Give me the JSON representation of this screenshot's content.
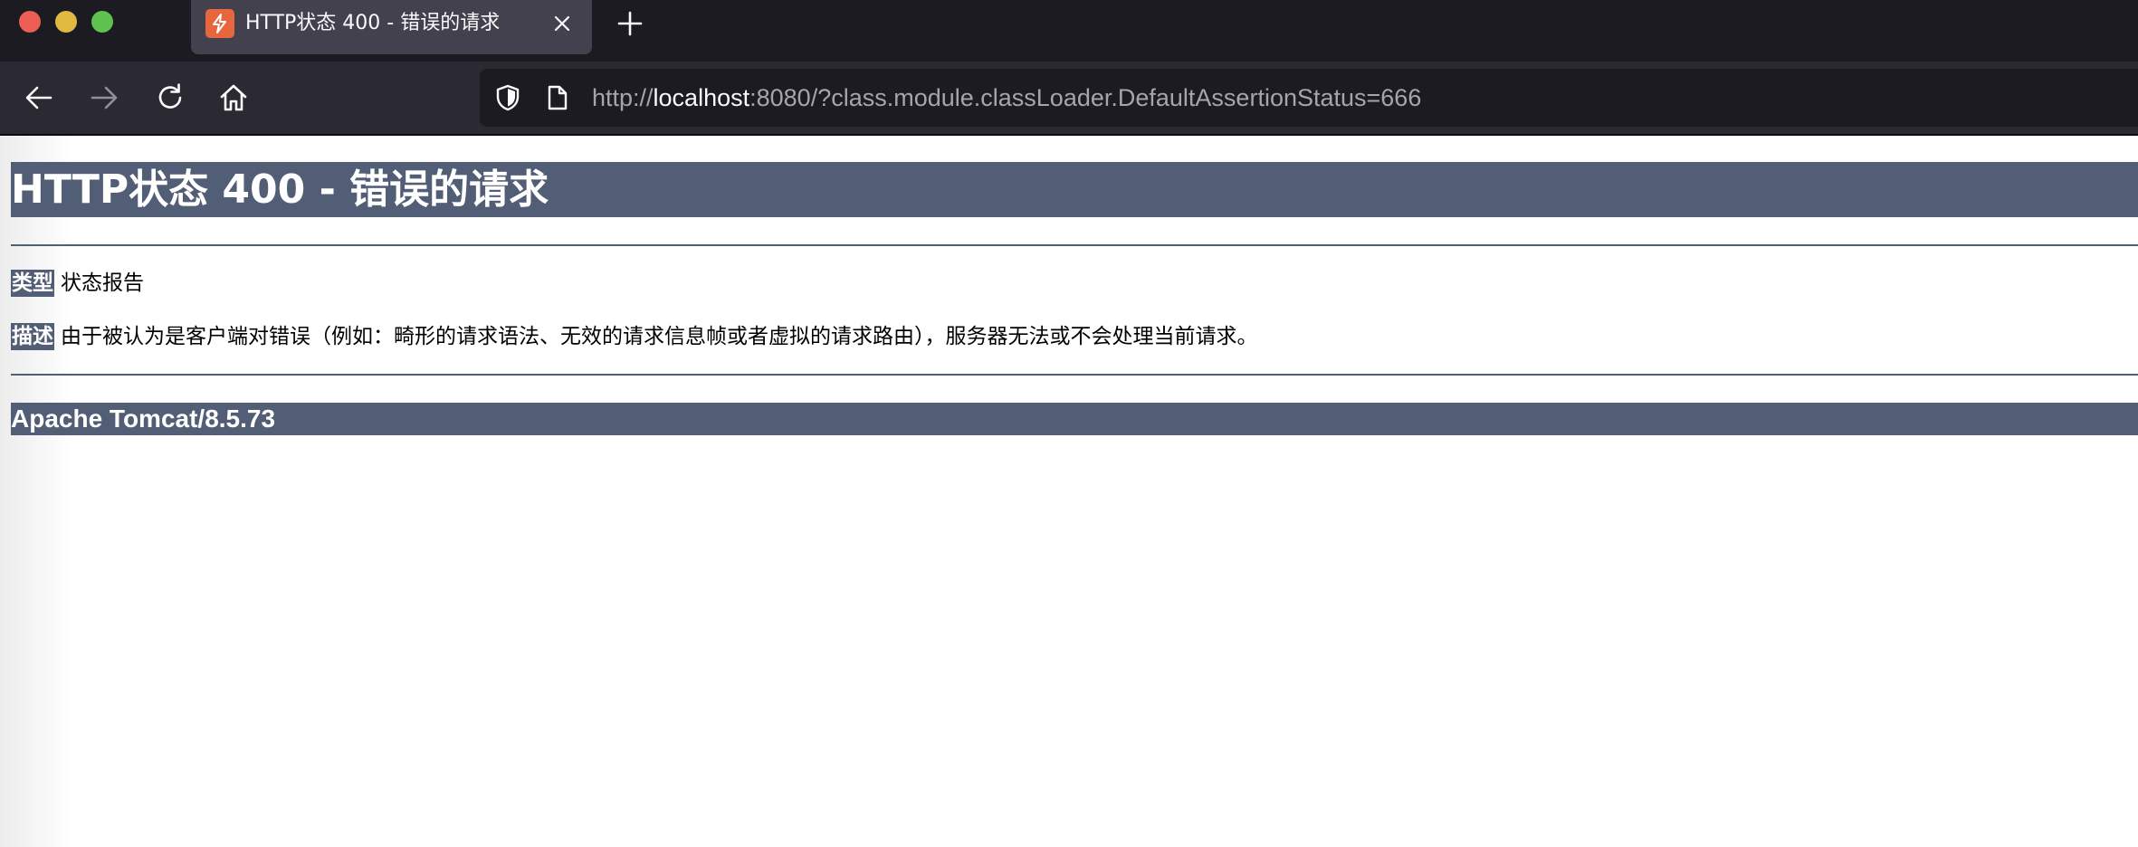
{
  "browser": {
    "tab": {
      "title": "HTTP状态 400 - 错误的请求",
      "favicon_color": "#e8663d"
    },
    "url": {
      "scheme": "http://",
      "host": "localhost",
      "rest": ":8080/?class.module.classLoader.DefaultAssertionStatus=666"
    },
    "icons": {
      "back": "arrow-left-icon",
      "forward": "arrow-right-icon",
      "reload": "reload-icon",
      "home": "home-icon",
      "shield": "shield-icon",
      "page": "page-icon",
      "close_tab": "close-icon",
      "new_tab": "plus-icon"
    }
  },
  "page": {
    "heading": "HTTP状态 400 - 错误的请求",
    "type_label": "类型",
    "type_value": "状态报告",
    "description_label": "描述",
    "description_value": "由于被认为是客户端对错误（例如：畸形的请求语法、无效的请求信息帧或者虚拟的请求路由），服务器无法或不会处理当前请求。",
    "server_info": "Apache Tomcat/8.5.73",
    "accent_color": "#525d76"
  }
}
